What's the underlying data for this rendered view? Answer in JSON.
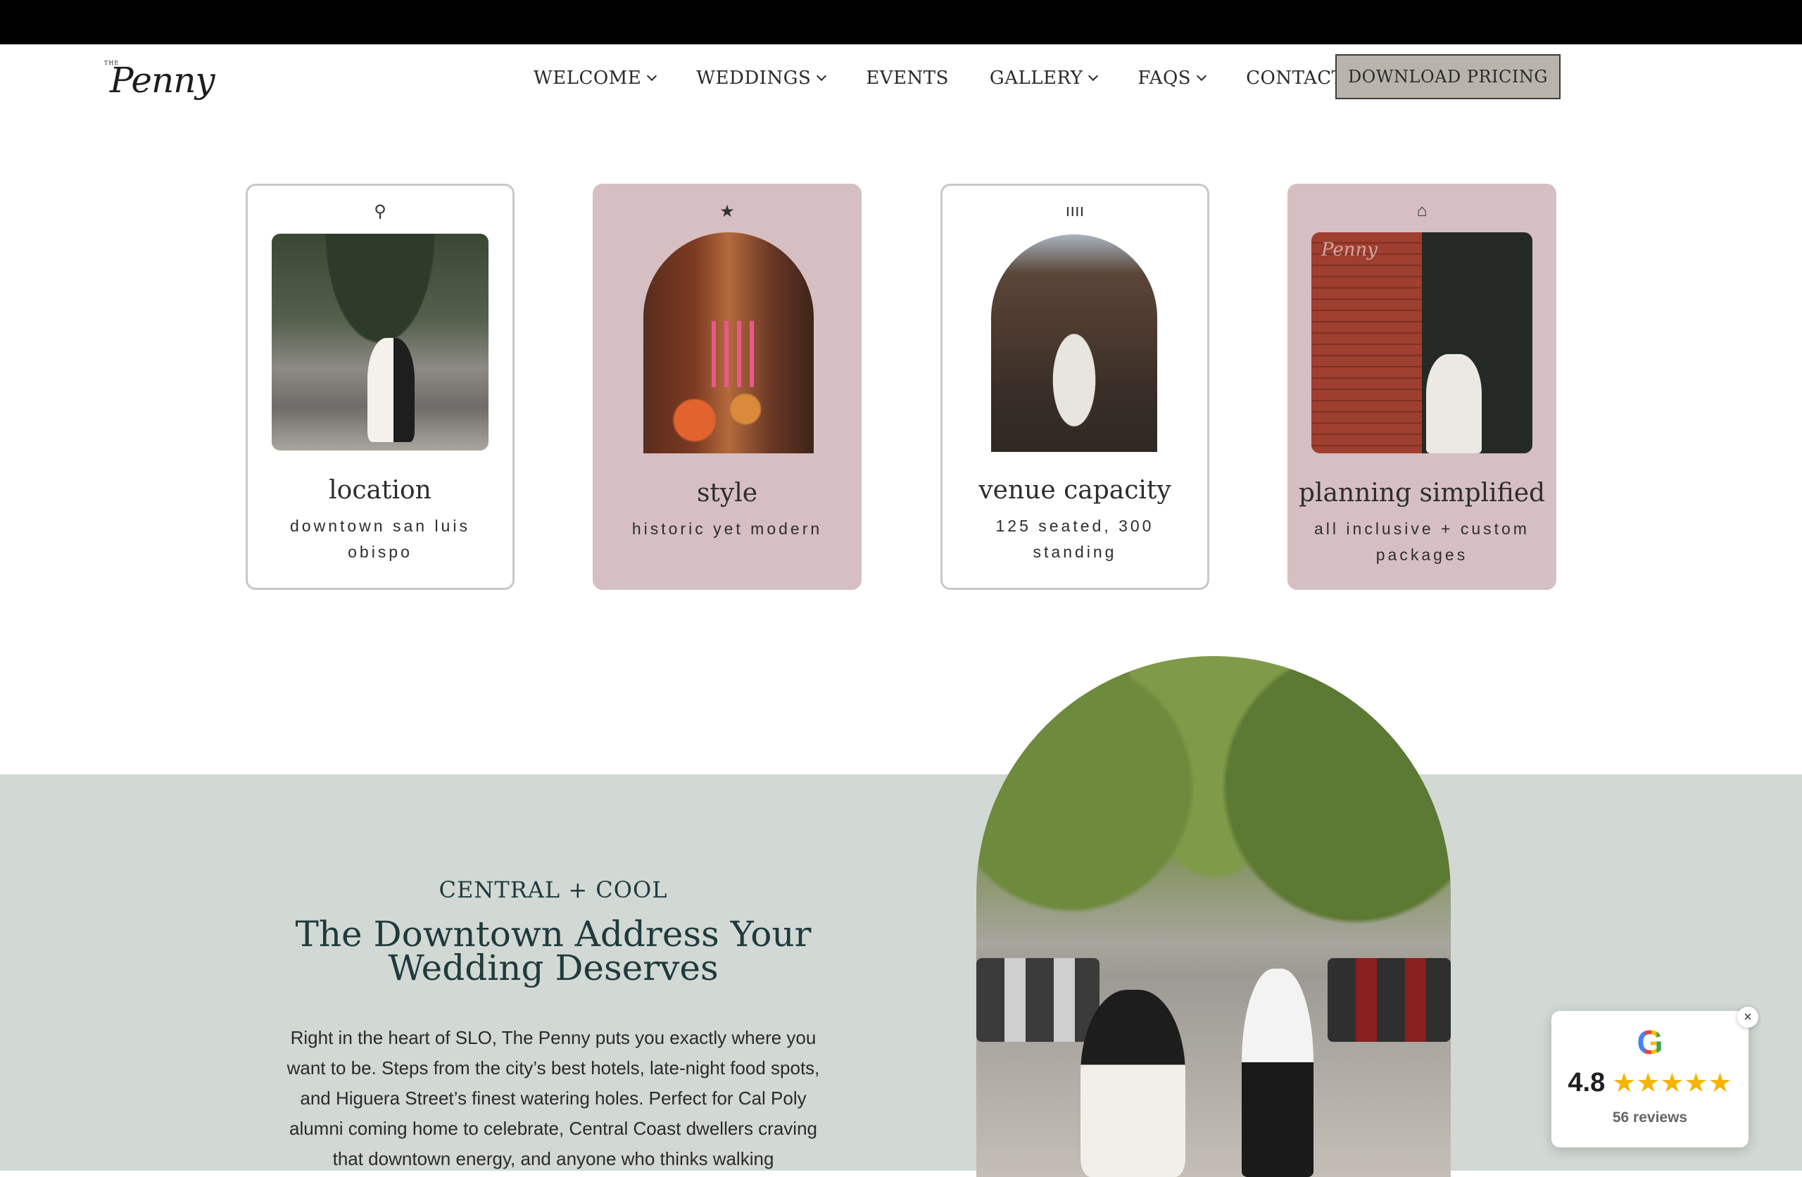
{
  "header": {
    "logo_small": "THE",
    "logo_script": "Penny",
    "nav": [
      {
        "label": "WELCOME",
        "has_dropdown": true
      },
      {
        "label": "WEDDINGS",
        "has_dropdown": true
      },
      {
        "label": "EVENTS",
        "has_dropdown": false
      },
      {
        "label": "GALLERY",
        "has_dropdown": true
      },
      {
        "label": "FAQS",
        "has_dropdown": true
      },
      {
        "label": "CONTACT",
        "has_dropdown": false
      }
    ],
    "cta_label": "DOWNLOAD PRICING"
  },
  "cards": [
    {
      "icon": "location-pin-icon",
      "glyph": "⚲",
      "title": "location",
      "sub": "downtown san luis obispo"
    },
    {
      "icon": "star-icon",
      "glyph": "★",
      "title": "style",
      "sub": "historic yet modern"
    },
    {
      "icon": "capacity-bars-icon",
      "glyph": "ıııı",
      "title": "venue capacity",
      "sub": "125 seated, 300 standing"
    },
    {
      "icon": "home-icon",
      "glyph": "⌂",
      "title": "planning simplified",
      "sub": "all inclusive + custom packages"
    }
  ],
  "card4_watermark": "Penny",
  "intro": {
    "eyebrow": "CENTRAL + COOL",
    "headline": "The Downtown Address Your Wedding Deserves",
    "body": "Right in the heart of SLO, The Penny puts you exactly where you want to be. Steps from the city’s best hotels, late-night food spots, and Higuera Street’s finest watering holes. Perfect for Cal Poly alumni coming home to celebrate, Central Coast dwellers craving that downtown energy, and anyone who thinks walking"
  },
  "review": {
    "logo": "G",
    "score": "4.8",
    "stars": "★★★★★",
    "count": "56 reviews",
    "close": "×"
  },
  "colors": {
    "card_pink": "#d6bfc2",
    "sage": "#d2d8d3",
    "button": "#b9b4ab",
    "heading_teal": "#1f3a3c"
  }
}
